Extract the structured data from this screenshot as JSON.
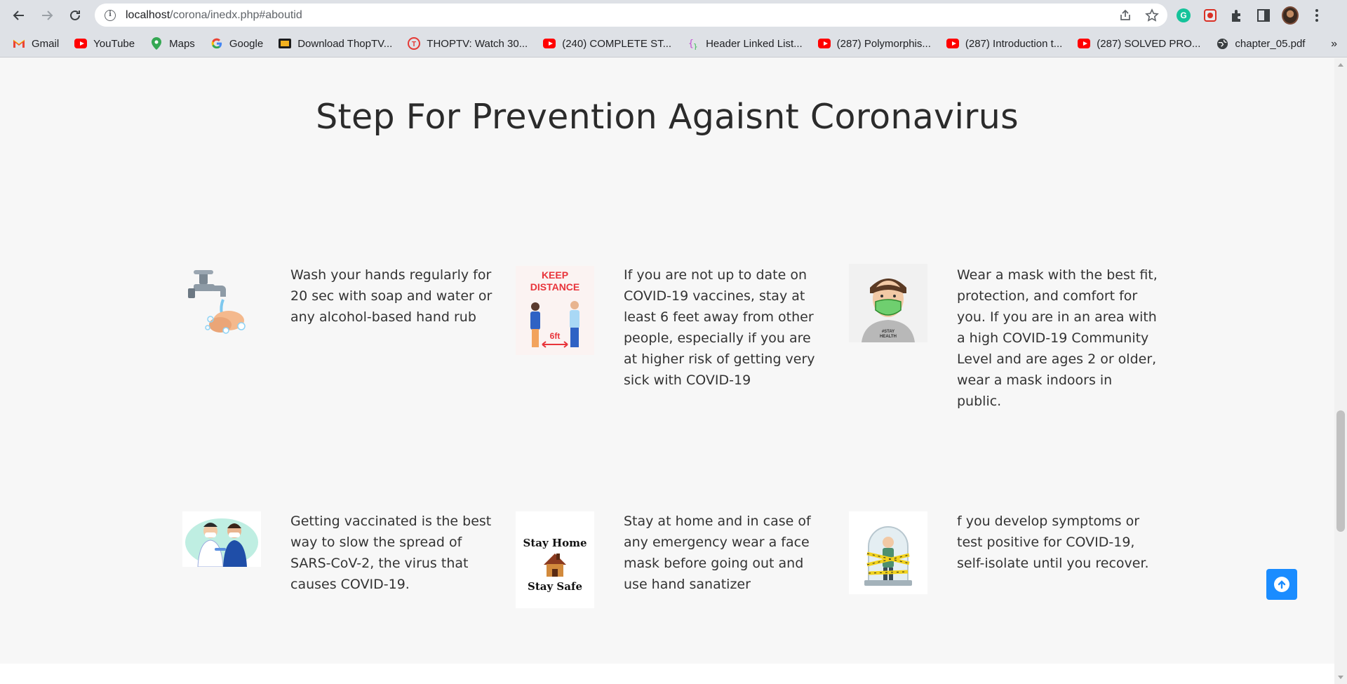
{
  "browser": {
    "url_host": "localhost",
    "url_path": "/corona/inedx.php#aboutid",
    "bookmarks": [
      {
        "label": "Gmail",
        "icon": "gmail-icon"
      },
      {
        "label": "YouTube",
        "icon": "youtube-icon"
      },
      {
        "label": "Maps",
        "icon": "maps-icon"
      },
      {
        "label": "Google",
        "icon": "google-icon"
      },
      {
        "label": "Download ThopTV...",
        "icon": "thoptv-icon"
      },
      {
        "label": "THOPTV: Watch 30...",
        "icon": "thoptv-red-icon"
      },
      {
        "label": "(240) COMPLETE ST...",
        "icon": "youtube-icon"
      },
      {
        "label": "Header Linked List...",
        "icon": "braces-icon"
      },
      {
        "label": "(287) Polymorphis...",
        "icon": "youtube-icon"
      },
      {
        "label": "(287) Introduction t...",
        "icon": "youtube-icon"
      },
      {
        "label": "(287) SOLVED PRO...",
        "icon": "youtube-icon"
      },
      {
        "label": "chapter_05.pdf",
        "icon": "globe-icon"
      }
    ],
    "more_label": "»"
  },
  "section": {
    "title": "Step For Prevention Agaisnt Coronavirus",
    "items": [
      {
        "text": "Wash your hands regularly for 20 sec with soap and water or any alcohol-based hand rub",
        "image": "handwash-image"
      },
      {
        "text": "If you are not up to date on COVID-19 vaccines, stay at least 6 feet away from other people, especially if you are at higher risk of getting very sick with COVID-19",
        "image": "keep-distance-image",
        "image_text": [
          "KEEP",
          "DISTANCE",
          "6ft"
        ]
      },
      {
        "text": "Wear a mask with the best fit, protection, and comfort for you. If you are in an area with a high COVID-19 Community Level and are ages 2 or older, wear a mask indoors in public.",
        "image": "mask-man-image",
        "image_text": [
          "#STAY",
          "HEALTH"
        ]
      },
      {
        "text": "Getting vaccinated is the best way to slow the spread of SARS-CoV-2, the virus that causes COVID-19.",
        "image": "vaccination-image"
      },
      {
        "text": "Stay at home and in case of any emergency wear a face mask before going out and use hand sanatizer",
        "image": "stay-home-image",
        "image_text": [
          "Stay Home",
          "Stay Safe"
        ]
      },
      {
        "text": "f you develop symptoms or test positive for COVID-19, self-isolate until you recover.",
        "image": "isolation-image"
      }
    ]
  },
  "colors": {
    "accent": "#1a8cff",
    "page_bg": "#f7f7f7",
    "text": "#333333"
  }
}
